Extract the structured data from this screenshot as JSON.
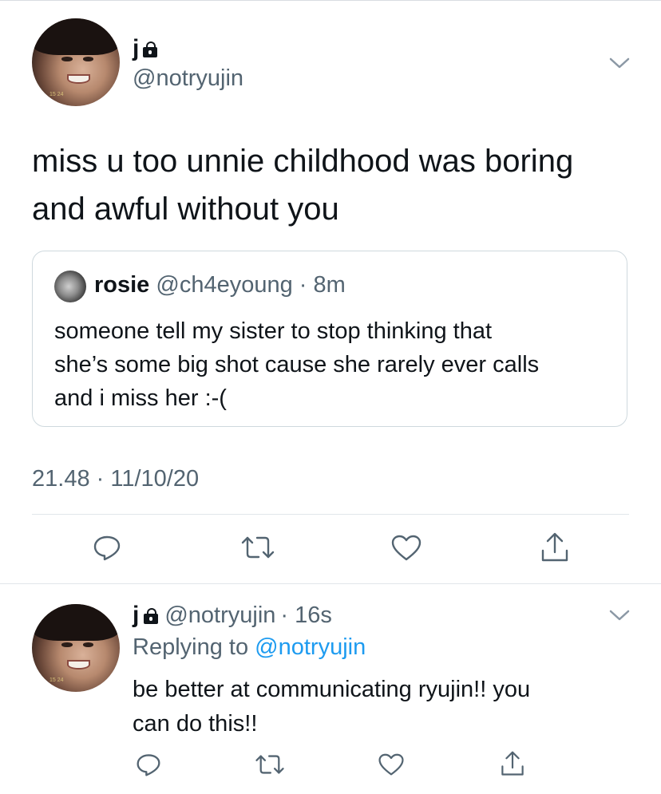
{
  "main_tweet": {
    "display_name": "j",
    "handle": "@notryujin",
    "text_line1": "miss u too unnie childhood was boring",
    "text_line2": "and awful without you",
    "timestamp": "21.48 · 11/10/20",
    "avatar_tag": "15 24"
  },
  "quoted_tweet": {
    "display_name": "rosie",
    "handle": "@ch4eyoung",
    "time": "· 8m",
    "text_line1": "someone tell my sister to stop thinking that",
    "text_line2": "she’s some big shot cause she rarely ever calls",
    "text_line3": "and i miss her :-("
  },
  "reply_tweet": {
    "display_name": "j",
    "handle": "@notryujin",
    "time": "· 16s",
    "replying_prefix": "Replying to",
    "replying_handle": "@notryujin",
    "text_line1": "be better at communicating ryujin!! you",
    "text_line2": "can do this!!",
    "avatar_tag": "15 24"
  },
  "icons": {
    "lock": "lock-icon",
    "chevron": "chevron-down-icon",
    "reply": "reply-icon",
    "retweet": "retweet-icon",
    "like": "heart-icon",
    "share": "share-icon"
  },
  "colors": {
    "text": "#0f1419",
    "secondary": "#536471",
    "link": "#1d9bf0",
    "border": "#cfd9de"
  }
}
